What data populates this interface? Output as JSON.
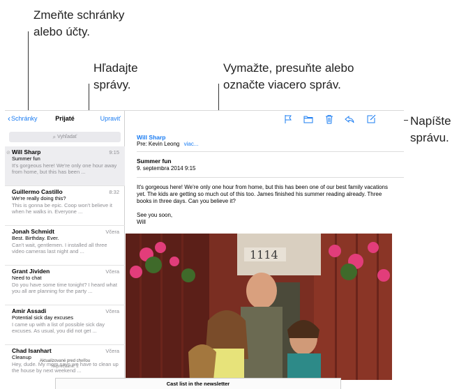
{
  "callouts": {
    "mailboxes": [
      "Zmeňte schránky",
      "alebo účty."
    ],
    "search": [
      "Hľadajte",
      "správy."
    ],
    "edit": [
      "Vymažte, presuňte alebo",
      "označte viacero správ."
    ],
    "compose": [
      "Napíšte",
      "správu."
    ]
  },
  "nav": {
    "back_label": "Schránky",
    "title": "Prijaté",
    "edit_label": "Upraviť"
  },
  "search": {
    "placeholder": "Vyhľadať"
  },
  "messages": [
    {
      "from": "Will Sharp",
      "time": "9:15",
      "subject": "Summer fun",
      "preview": "It's gorgeous here! We're only one hour away from home, but this has been ..."
    },
    {
      "from": "Guillermo Castillo",
      "time": "8:32",
      "subject": "We're really doing this?",
      "preview": "This is gonna be epic. Coop won't believe it when he walks in. Everyone ..."
    },
    {
      "from": "Jonah Schmidt",
      "time": "Včera",
      "subject": "Best. Birthday. Ever.",
      "preview": "Can't wait, gentlemen. I installed all three video cameras last night and ..."
    },
    {
      "from": "Grant Jividen",
      "time": "Včera",
      "subject": "Need to chat",
      "preview": "Do you have some time tonight? I heard what you all are planning for the party ..."
    },
    {
      "from": "Amir Assadi",
      "time": "Včera",
      "subject": "Potential sick day excuses",
      "preview": "I came up with a list of possible sick day excuses. As usual, you did not get ..."
    },
    {
      "from": "Chad Isanhart",
      "time": "Včera",
      "subject": "Cleanup",
      "preview": "Hey, dude. My mom says we have to clean up the house by next weekend ..."
    }
  ],
  "footer": {
    "updated": "Aktualizované pred chvíľou",
    "unread": "Neprečítané: 2"
  },
  "detail": {
    "sender": "Will Sharp",
    "to_line": "Pre: Kevin Leong",
    "more_label": "viac...",
    "subject": "Summer fun",
    "date": "9. septembra 2014 9:15",
    "body_p1": "It's gorgeous here! We're only one hour from home, but this has been one of our best family vacations yet. The kids are getting so much out of this too. James finished his summer reading already. Three books in three days. Can you believe it?",
    "body_p2a": "See you soon,",
    "body_p2b": "Will",
    "house_number": "1114"
  },
  "banner": {
    "text": "Cast list in the newsletter"
  },
  "colors": {
    "accent": "#1a7cf2",
    "secondary_text": "#8e8e93"
  }
}
